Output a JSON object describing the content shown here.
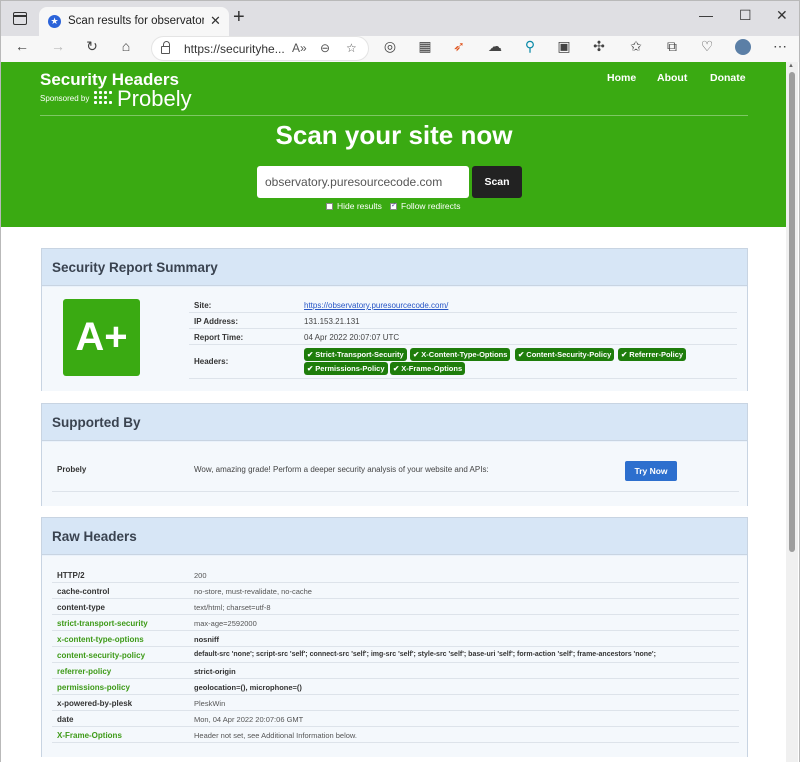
{
  "browser": {
    "tab_title": "Scan results for observatory.pure",
    "tab_close": "✕",
    "new_tab": "+",
    "address": "https://securityhe...",
    "window_controls": {
      "minimize": "—",
      "maximize": "☐",
      "close": "✕"
    }
  },
  "site": {
    "brand": "Security Headers",
    "sponsored_by": "Sponsored by",
    "sponsor_logo": "Probely",
    "nav": [
      "Home",
      "About",
      "Donate"
    ],
    "hero_title": "Scan your site now",
    "scan_input_value": "observatory.puresourcecode.com",
    "scan_button": "Scan",
    "option_hide_results": "Hide results",
    "option_follow_redirects": "Follow redirects",
    "hide_results_checked": false,
    "follow_redirects_checked": true
  },
  "summary": {
    "title": "Security Report Summary",
    "grade": "A+",
    "rows": [
      {
        "key": "Site:",
        "value": "https://observatory.puresourcecode.com/"
      },
      {
        "key": "IP Address:",
        "value": "131.153.21.131"
      },
      {
        "key": "Report Time:",
        "value": "04 Apr 2022 20:07:07 UTC"
      },
      {
        "key": "Headers:",
        "value": ""
      }
    ],
    "headers_badges": [
      "Strict-Transport-Security",
      "X-Content-Type-Options",
      "Content-Security-Policy",
      "Referrer-Policy",
      "Permissions-Policy",
      "X-Frame-Options"
    ]
  },
  "supported": {
    "title": "Supported By",
    "name": "Probely",
    "text": "Wow, amazing grade! Perform a deeper security analysis of your website and APIs:",
    "button": "Try Now"
  },
  "raw": {
    "title": "Raw Headers",
    "rows": [
      {
        "key": "HTTP/2",
        "value": "200"
      },
      {
        "key": "cache-control",
        "value": "no-store, must-revalidate, no-cache"
      },
      {
        "key": "content-type",
        "value": "text/html; charset=utf-8"
      },
      {
        "key": "strict-transport-security",
        "value": "max-age=2592000"
      },
      {
        "key": "x-content-type-options",
        "value": "nosniff"
      },
      {
        "key": "content-security-policy",
        "value": "default-src 'none'; script-src 'self'; connect-src 'self'; img-src 'self'; style-src 'self'; base-uri 'self'; form-action 'self'; frame-ancestors 'none';"
      },
      {
        "key": "referrer-policy",
        "value": "strict-origin"
      },
      {
        "key": "permissions-policy",
        "value": "geolocation=(), microphone=()"
      },
      {
        "key": "x-powered-by-plesk",
        "value": "PleskWin"
      },
      {
        "key": "date",
        "value": "Mon, 04 Apr 2022 20:07:06 GMT"
      },
      {
        "key": "X-Frame-Options",
        "value": "Header not set, see Additional Information below."
      }
    ]
  },
  "colors": {
    "brand_green": "#3aaa12",
    "badge_green": "#1e7d0b",
    "panel_bg": "#eaf2fb",
    "try_button": "#2d6fce"
  }
}
